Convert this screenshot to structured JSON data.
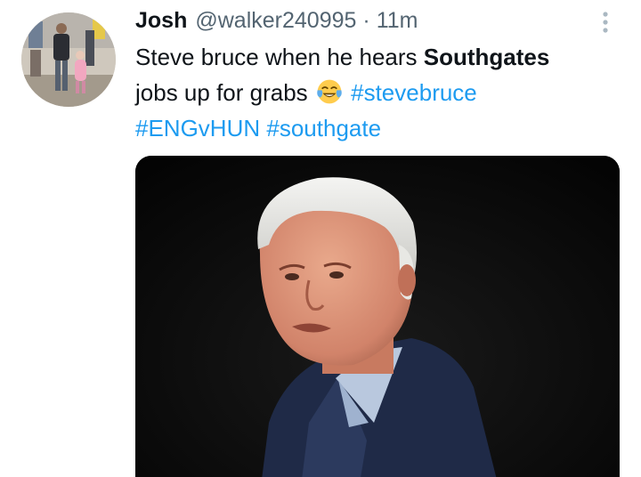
{
  "tweet": {
    "author_name": "Josh",
    "handle": "@walker240995",
    "separator": "·",
    "time": "11m",
    "text_part1": "Steve bruce when he hears ",
    "text_bold": "Southgates",
    "text_part2": " jobs up for grabs ",
    "emoji": "face-with-tears-of-joy",
    "hashtags": [
      "#stevebruce",
      "#ENGvHUN",
      "#southgate"
    ]
  },
  "icons": {
    "more": "more-vertical-icon"
  },
  "colors": {
    "text": "#0f1419",
    "secondary": "#536471",
    "link": "#1d9bf0",
    "media_bg": "#050505"
  }
}
